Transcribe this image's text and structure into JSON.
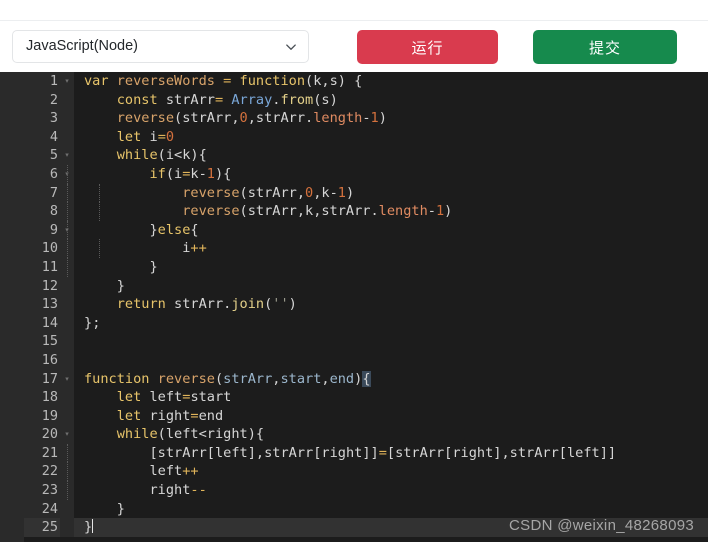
{
  "toolbar": {
    "language_select": {
      "value": "JavaScript(Node)",
      "icon": "chevron-down-icon"
    },
    "run_label": "运行",
    "submit_label": "提交",
    "run_color": "#d93b4e",
    "submit_color": "#168a4d"
  },
  "editor": {
    "background": "#1c1c1c",
    "gutter_background": "#2a2a2a",
    "active_line_background": "#323232",
    "active_line": 25,
    "total_lines": 25,
    "fold_marker": "▾",
    "fold_lines": [
      1,
      5,
      6,
      9,
      17,
      20
    ],
    "lines": [
      {
        "n": 1,
        "text": "var reverseWords = function(k,s) {"
      },
      {
        "n": 2,
        "text": "    const strArr= Array.from(s)"
      },
      {
        "n": 3,
        "text": "    reverse(strArr,0,strArr.length-1)"
      },
      {
        "n": 4,
        "text": "    let i=0"
      },
      {
        "n": 5,
        "text": "    while(i<k){"
      },
      {
        "n": 6,
        "text": "        if(i=k-1){"
      },
      {
        "n": 7,
        "text": "            reverse(strArr,0,k-1)"
      },
      {
        "n": 8,
        "text": "            reverse(strArr,k,strArr.length-1)"
      },
      {
        "n": 9,
        "text": "        }else{"
      },
      {
        "n": 10,
        "text": "            i++"
      },
      {
        "n": 11,
        "text": "        }"
      },
      {
        "n": 12,
        "text": "    }"
      },
      {
        "n": 13,
        "text": "    return strArr.join('')"
      },
      {
        "n": 14,
        "text": "};"
      },
      {
        "n": 15,
        "text": ""
      },
      {
        "n": 16,
        "text": ""
      },
      {
        "n": 17,
        "text": "function reverse(strArr,start,end){"
      },
      {
        "n": 18,
        "text": "    let left=start"
      },
      {
        "n": 19,
        "text": "    let right=end"
      },
      {
        "n": 20,
        "text": "    while(left<right){"
      },
      {
        "n": 21,
        "text": "        [strArr[left],strArr[right]]=[strArr[right],strArr[left]]"
      },
      {
        "n": 22,
        "text": "        left++"
      },
      {
        "n": 23,
        "text": "        right--"
      },
      {
        "n": 24,
        "text": "    }"
      },
      {
        "n": 25,
        "text": "}"
      }
    ]
  },
  "watermark": "CSDN @weixin_48268093"
}
